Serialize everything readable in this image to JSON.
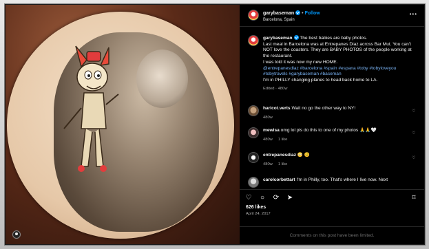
{
  "header": {
    "username": "garybaseman",
    "follow_label": "Follow",
    "location": "Barcelona, Spain",
    "more_icon": "more-icon"
  },
  "caption": {
    "username": "garybaseman",
    "line1": "The best babies are baby photos.",
    "body": "Last meal in Barcelona was at Entrepanes Diaz across Bar Mut. You can't NOT love the coasters. They are BABY PHOTOS of the people working at the restaurant.",
    "line_home": "I was told it was now my new HOME.",
    "tags": "@entrepanesdiaz #barcelona #spain #espana #toby #tobyloveyou #tobytravels #garybaseman #baseman",
    "closing": "I'm in PHILLY changing planes to head back home to LA.",
    "meta": "Edited · 480w"
  },
  "comments": [
    {
      "username": "haricot.verts",
      "text": "Wait no go the other way to NY!",
      "time": "480w",
      "likes": ""
    },
    {
      "username": "mewisa",
      "text": "omg lol pls do this to one of my photos 🙏🙏🤍",
      "time": "480w",
      "likes": "1 like"
    },
    {
      "username": "entrepanesdiaz",
      "text": "😳 😊",
      "time": "480w",
      "likes": "1 like"
    },
    {
      "username": "carolcorbettart",
      "text": "I'm in Philly, too. That's where I live now. Next",
      "time": "",
      "likes": ""
    }
  ],
  "actions": {
    "like_icon": "heart-icon",
    "comment_icon": "comment-icon",
    "share_icon": "share-icon",
    "save_icon": "bookmark-icon"
  },
  "likes_label": "626 likes",
  "date": "April 24, 2017",
  "limited_text": "Comments on this post have been limited.",
  "colors": {
    "background": "#000000",
    "link": "#0095f6",
    "hashtag": "#7ab4f5",
    "muted": "#a8a8a8"
  }
}
